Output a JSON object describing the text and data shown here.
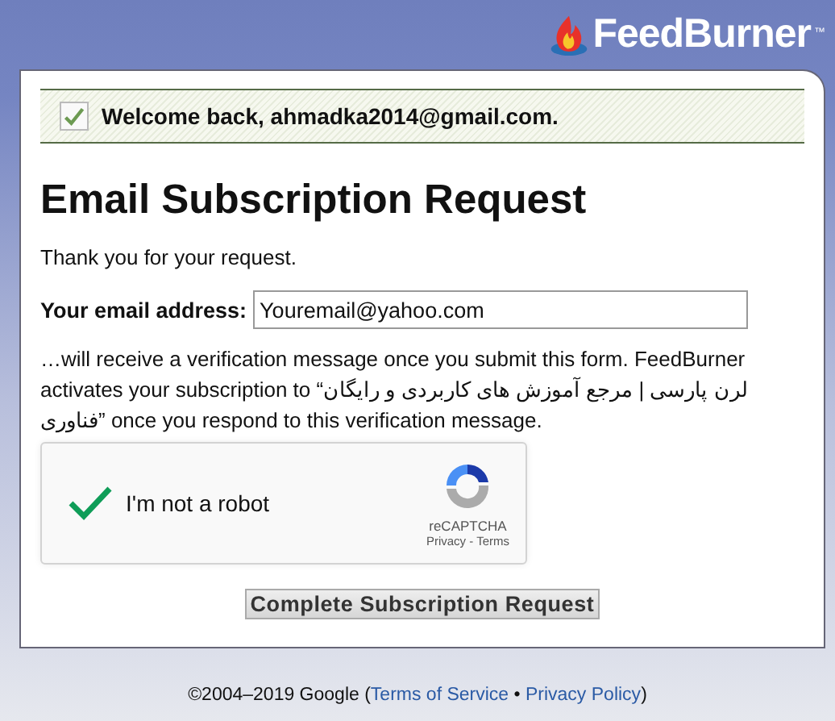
{
  "header": {
    "logo_text": "FeedBurner",
    "trademark": "™"
  },
  "welcome": {
    "text": "Welcome back, ahmadka2014@gmail.com.",
    "checked": true
  },
  "title": "Email Subscription Request",
  "intro": "Thank you for your request.",
  "email": {
    "label": "Your email address:",
    "value": "Youremail@yahoo.com"
  },
  "message": "…will receive a verification message once you submit this form. FeedBurner activates your subscription to “لرن پارسی | مرجع آموزش های کاربردی و رایگان فناوری” once you respond to this verification message.",
  "captcha": {
    "label": "I'm not a robot",
    "checked": true,
    "brand": "reCAPTCHA",
    "privacy": "Privacy",
    "separator": " - ",
    "terms": "Terms"
  },
  "submit": "Complete Subscription Request",
  "footer": {
    "copyright": "©2004–2019 Google (",
    "terms": "Terms of Service",
    "bullet": " • ",
    "privacy": "Privacy Policy",
    "close": ")"
  }
}
